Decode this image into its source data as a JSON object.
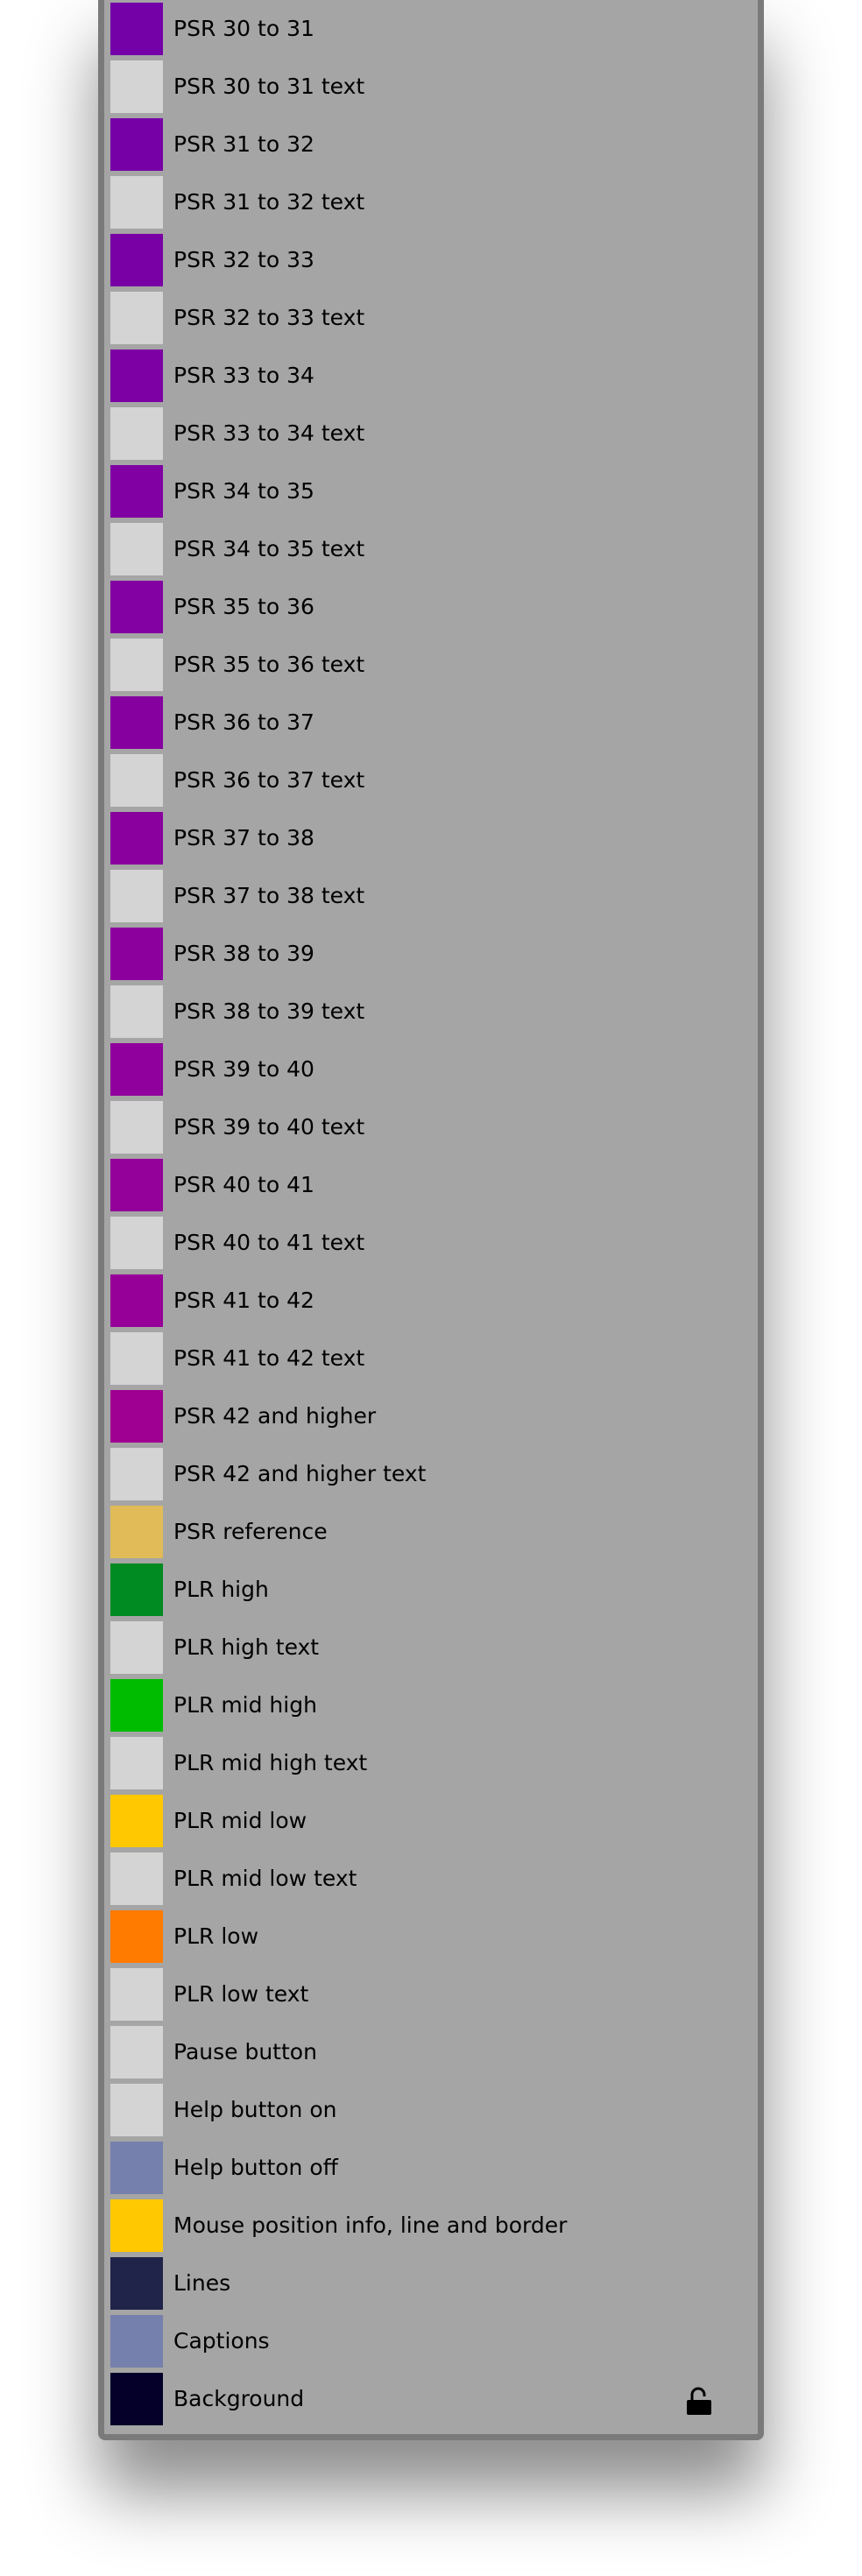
{
  "items": [
    {
      "label": "PSR 30 to 31",
      "color": "#7400a8"
    },
    {
      "label": "PSR 30 to 31 text",
      "color": "#d4d4d4"
    },
    {
      "label": "PSR 31 to 32",
      "color": "#7600a6"
    },
    {
      "label": "PSR 31 to 32 text",
      "color": "#d4d4d4"
    },
    {
      "label": "PSR 32 to 33",
      "color": "#7900a5"
    },
    {
      "label": "PSR 32 to 33 text",
      "color": "#d4d4d4"
    },
    {
      "label": "PSR 33 to 34",
      "color": "#7c00a4"
    },
    {
      "label": "PSR 33 to 34 text",
      "color": "#d4d4d4"
    },
    {
      "label": "PSR 34 to 35",
      "color": "#8000a3"
    },
    {
      "label": "PSR 34 to 35 text",
      "color": "#d4d4d4"
    },
    {
      "label": "PSR 35 to 36",
      "color": "#8300a2"
    },
    {
      "label": "PSR 35 to 36 text",
      "color": "#d4d4d4"
    },
    {
      "label": "PSR 36 to 37",
      "color": "#8600a0"
    },
    {
      "label": "PSR 36 to 37 text",
      "color": "#d4d4d4"
    },
    {
      "label": "PSR 37 to 38",
      "color": "#89009f"
    },
    {
      "label": "PSR 37 to 38 text",
      "color": "#d4d4d4"
    },
    {
      "label": "PSR 38 to 39",
      "color": "#8c009e"
    },
    {
      "label": "PSR 38 to 39 text",
      "color": "#d4d4d4"
    },
    {
      "label": "PSR 39 to 40",
      "color": "#90009c"
    },
    {
      "label": "PSR 39 to 40 text",
      "color": "#d4d4d4"
    },
    {
      "label": "PSR 40 to 41",
      "color": "#93009a"
    },
    {
      "label": "PSR 40 to 41 text",
      "color": "#d4d4d4"
    },
    {
      "label": "PSR 41 to 42",
      "color": "#970098"
    },
    {
      "label": "PSR 41 to 42 text",
      "color": "#d4d4d4"
    },
    {
      "label": "PSR 42 and higher",
      "color": "#a00092"
    },
    {
      "label": "PSR 42 and higher text",
      "color": "#d4d4d4"
    },
    {
      "label": "PSR reference",
      "color": "#e0bb58"
    },
    {
      "label": "PLR high",
      "color": "#008a22"
    },
    {
      "label": "PLR high text",
      "color": "#d4d4d4"
    },
    {
      "label": "PLR mid high",
      "color": "#00bc00"
    },
    {
      "label": "PLR mid high text",
      "color": "#d4d4d4"
    },
    {
      "label": "PLR mid low",
      "color": "#ffc800"
    },
    {
      "label": "PLR mid low text",
      "color": "#d4d4d4"
    },
    {
      "label": "PLR low",
      "color": "#ff7b00"
    },
    {
      "label": "PLR low text",
      "color": "#d4d4d4"
    },
    {
      "label": "Pause button",
      "color": "#d4d4d4"
    },
    {
      "label": "Help button on",
      "color": "#d4d4d4"
    },
    {
      "label": "Help button off",
      "color": "#7680ad"
    },
    {
      "label": "Mouse position info, line and border",
      "color": "#ffc800"
    },
    {
      "label": "Lines",
      "color": "#20244a"
    },
    {
      "label": "Captions",
      "color": "#7680ad"
    },
    {
      "label": "Background",
      "color": "#04002a"
    }
  ],
  "lock_icon": "lock-open-icon"
}
